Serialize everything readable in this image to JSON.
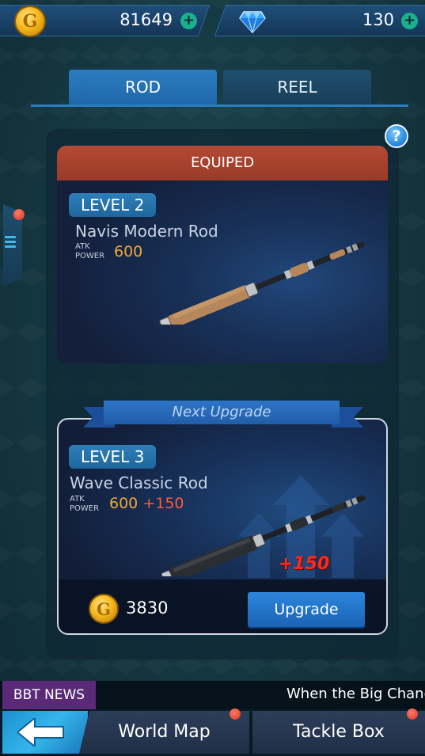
{
  "currency": {
    "gold_icon_letter": "G",
    "gold_amount": "81649",
    "gold_add_icon": "plus-icon",
    "gem_icon": "diamond-icon",
    "gem_amount": "130",
    "gem_add_icon": "plus-icon"
  },
  "tabs": [
    {
      "label": "ROD",
      "active": true
    },
    {
      "label": "REEL",
      "active": false
    }
  ],
  "help_icon": "?",
  "equipped": {
    "header": "EQUIPED",
    "level": "LEVEL 2",
    "rod_name": "Navis Modern Rod",
    "atk_label_1": "ATK",
    "atk_label_2": "POWER",
    "atk_value": "600"
  },
  "next_upgrade": {
    "ribbon": "Next Upgrade",
    "level": "LEVEL 3",
    "rod_name": "Wave Classic Rod",
    "atk_label_1": "ATK",
    "atk_label_2": "POWER",
    "atk_value": "600",
    "atk_bonus": "+150",
    "bonus_overlay": "+150",
    "cost_icon_letter": "G",
    "cost": "3830",
    "upgrade_label": "Upgrade"
  },
  "news": {
    "tag": "BBT NEWS",
    "ticker": "When the Big Chance"
  },
  "nav": {
    "back_icon": "back-arrow-icon",
    "world_map": "World Map",
    "tackle_box": "Tackle Box"
  },
  "colors": {
    "accent_blue": "#2b7dc0",
    "equipped_red": "#b44a34",
    "atk_orange": "#f2a73a",
    "bonus_red": "#ff5a3c",
    "news_purple": "#5a2a78"
  }
}
